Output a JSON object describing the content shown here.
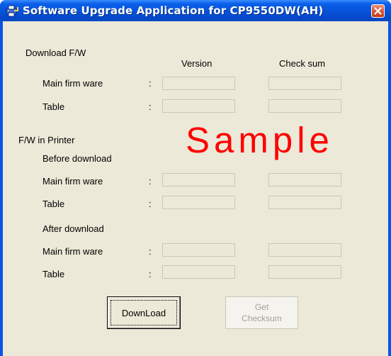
{
  "window": {
    "title": "Software Upgrade Application for CP9550DW(AH)"
  },
  "icons": {
    "app": "printer-app-icon",
    "close": "close-icon"
  },
  "headers": {
    "download_fw": "Download F/W",
    "version": "Version",
    "checksum": "Check sum",
    "fw_in_printer": "F/W in Printer",
    "before_download": "Before download",
    "after_download": "After download"
  },
  "rows": {
    "main_firmware": "Main firm ware",
    "table": "Table",
    "colon": ":"
  },
  "fields": {
    "download_main_version": "",
    "download_main_checksum": "",
    "download_table_version": "",
    "download_table_checksum": "",
    "before_main_version": "",
    "before_main_checksum": "",
    "before_table_version": "",
    "before_table_checksum": "",
    "after_main_version": "",
    "after_main_checksum": "",
    "after_table_version": "",
    "after_table_checksum": ""
  },
  "watermark": "Sample",
  "buttons": {
    "download": "DownLoad",
    "get_checksum_line1": "Get",
    "get_checksum_line2": "Checksum"
  },
  "colors": {
    "titlebar": "#0653d9",
    "dialog_bg": "#ece9d8",
    "watermark": "#ff0000",
    "disabled_text": "#a3a196"
  }
}
